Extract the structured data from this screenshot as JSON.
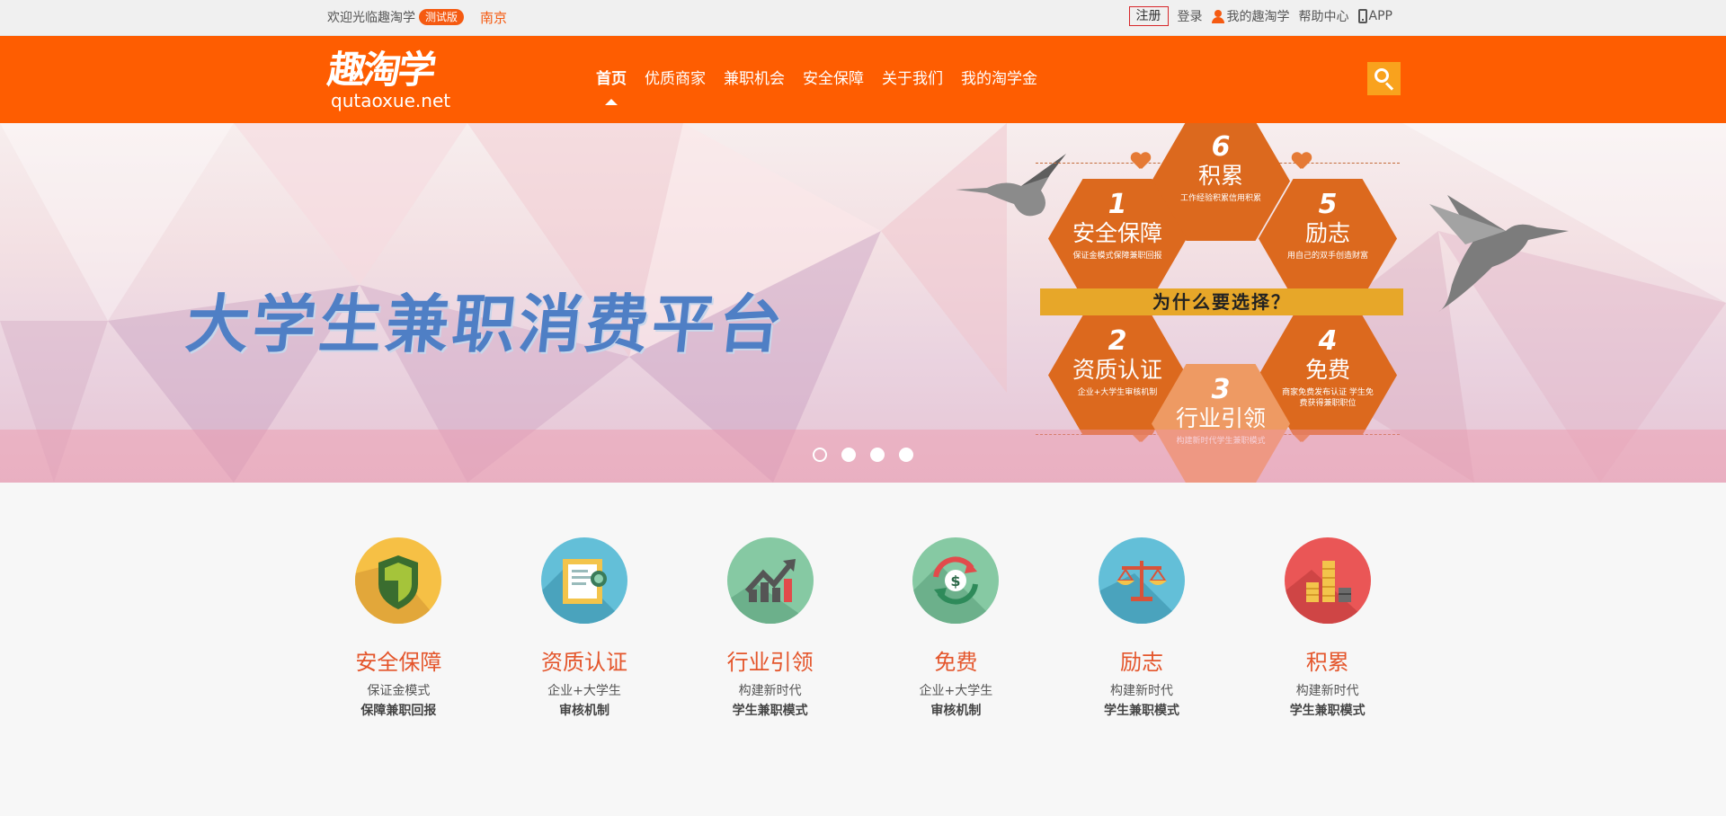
{
  "topbar": {
    "welcome": "欢迎光临趣淘学",
    "badge": "测试版",
    "city": "南京",
    "register": "注册",
    "login": "登录",
    "my_account": "我的趣淘学",
    "help": "帮助中心",
    "app": "APP"
  },
  "header": {
    "logo_cn": "趣淘学",
    "logo_en": "qutaoxue.net",
    "nav": [
      {
        "label": "首页",
        "active": true
      },
      {
        "label": "优质商家"
      },
      {
        "label": "兼职机会"
      },
      {
        "label": "安全保障"
      },
      {
        "label": "关于我们"
      },
      {
        "label": "我的淘学金"
      }
    ]
  },
  "banner": {
    "slogan": "大学生兼职消费平台",
    "why": "为什么要选择？",
    "hexes": [
      {
        "num": "6",
        "title": "积累",
        "sub": "工作经验积累信用积累"
      },
      {
        "num": "1",
        "title": "安全保障",
        "sub": "保证金模式保障兼职回报"
      },
      {
        "num": "5",
        "title": "励志",
        "sub": "用自己的双手创造财富"
      },
      {
        "num": "2",
        "title": "资质认证",
        "sub": "企业+大学生审核机制"
      },
      {
        "num": "4",
        "title": "免费",
        "sub": "商家免费发布认证 学生免费获得兼职职位"
      },
      {
        "num": "3",
        "title": "行业引领",
        "sub": "构建新时代学生兼职模式"
      }
    ],
    "slides": 4,
    "active_slide": 1
  },
  "features": [
    {
      "icon": "shield-icon",
      "color": "#f6c045",
      "title": "安全保障",
      "line1": "保证金模式",
      "line2": "保障兼职回报"
    },
    {
      "icon": "certificate-icon",
      "color": "#63bfd8",
      "title": "资质认证",
      "line1": "企业+大学生",
      "line2": "审核机制"
    },
    {
      "icon": "growth-chart-icon",
      "color": "#86c9a3",
      "title": "行业引领",
      "line1": "构建新时代",
      "line2": "学生兼职模式"
    },
    {
      "icon": "dollar-exchange-icon",
      "color": "#86c9a3",
      "title": "免费",
      "line1": "企业+大学生",
      "line2": "审核机制"
    },
    {
      "icon": "scale-icon",
      "color": "#63bfd8",
      "title": "励志",
      "line1": "构建新时代",
      "line2": "学生兼职模式"
    },
    {
      "icon": "coins-stack-icon",
      "color": "#ea5656",
      "title": "积累",
      "line1": "构建新时代",
      "line2": "学生兼职模式"
    }
  ]
}
